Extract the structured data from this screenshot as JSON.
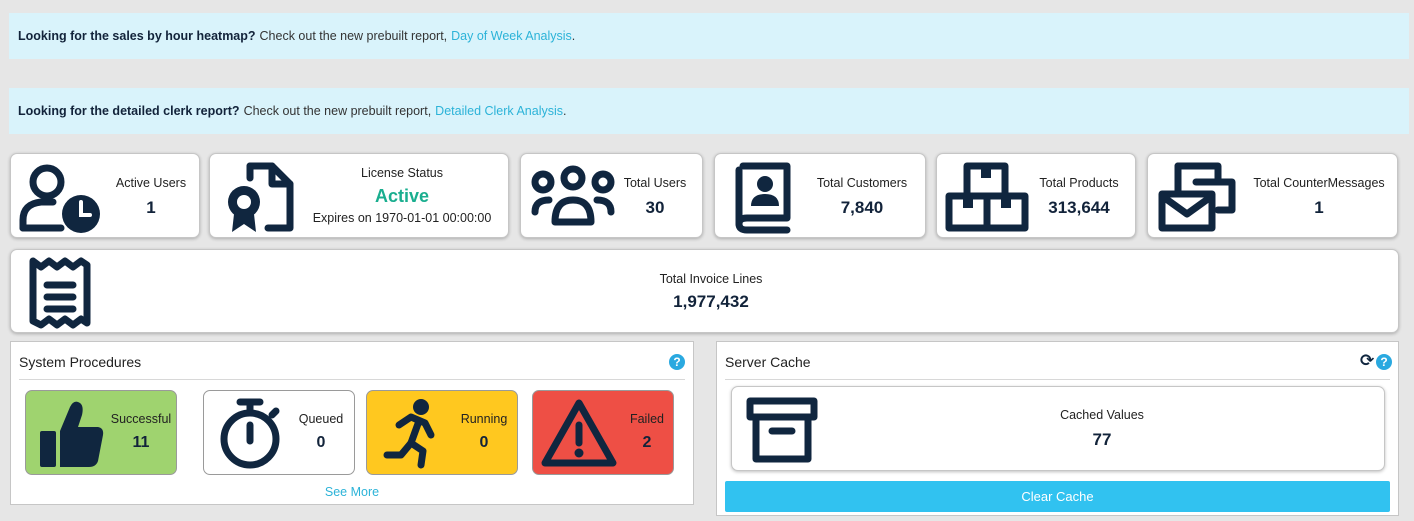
{
  "banners": [
    {
      "bold": "Looking for the sales by hour heatmap?",
      "text": "Check out the new prebuilt report,",
      "link": "Day of Week Analysis",
      "suffix": "."
    },
    {
      "bold": "Looking for the detailed clerk report?",
      "text": "Check out the new prebuilt report,",
      "link": "Detailed Clerk Analysis",
      "suffix": "."
    }
  ],
  "cards": {
    "active_users": {
      "label": "Active Users",
      "value": "1",
      "icon": "user-clock-icon"
    },
    "license": {
      "label": "License Status",
      "status": "Active",
      "expires": "Expires on 1970-01-01 00:00:00",
      "status_color": "#1aae8f",
      "icon": "certificate-icon"
    },
    "total_users": {
      "label": "Total Users",
      "value": "30",
      "icon": "users-group-icon"
    },
    "total_customers": {
      "label": "Total Customers",
      "value": "7,840",
      "icon": "contact-book-icon"
    },
    "total_products": {
      "label": "Total Products",
      "value": "313,644",
      "icon": "boxes-icon"
    },
    "total_counter_messages": {
      "label": "Total CounterMessages",
      "value": "1",
      "icon": "envelopes-icon"
    },
    "total_invoice_lines": {
      "label": "Total Invoice Lines",
      "value": "1,977,432",
      "icon": "receipt-icon"
    }
  },
  "system_procedures": {
    "title": "System Procedures",
    "help": "?",
    "stats": [
      {
        "label": "Successful",
        "value": "11",
        "color": "#9fd36f",
        "icon": "thumbs-up-icon"
      },
      {
        "label": "Queued",
        "value": "0",
        "color": "#ffffff",
        "icon": "stopwatch-icon"
      },
      {
        "label": "Running",
        "value": "0",
        "color": "#ffc81f",
        "icon": "running-icon"
      },
      {
        "label": "Failed",
        "value": "2",
        "color": "#ee4f45",
        "icon": "warning-icon"
      }
    ],
    "see_more": "See More"
  },
  "server_cache": {
    "title": "Server Cache",
    "help": "?",
    "refresh_icon": "refresh-icon",
    "cached_label": "Cached Values",
    "cached_value": "77",
    "icon": "archive-box-icon",
    "clear_button": "Clear Cache"
  },
  "colors": {
    "accent": "#31c2f0",
    "link": "#2cb3d8",
    "banner_bg": "#d9f3fb",
    "icon": "#10263f"
  }
}
